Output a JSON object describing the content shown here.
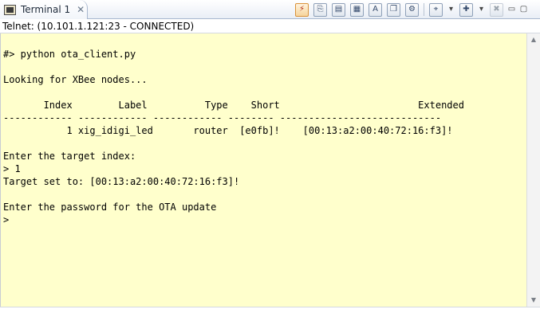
{
  "tab": {
    "title": "Terminal 1",
    "close_glyph": "✕",
    "icon": "terminal-icon"
  },
  "toolbar": {
    "icons": [
      "connect-icon",
      "disconnect-icon",
      "remote-command-icon",
      "scroll-lock-icon",
      "clear-icon",
      "copy-icon",
      "settings-icon",
      "pin-icon",
      "new-terminal-icon",
      "remove-icon",
      "minimize-icon",
      "maximize-icon"
    ]
  },
  "status": {
    "text": "Telnet: (10.101.1.121:23 - CONNECTED)"
  },
  "terminal": {
    "background": "#ffffcc",
    "lines": [
      "#> python ota_client.py",
      "",
      "Looking for XBee nodes...",
      "",
      "       Index        Label          Type    Short                        Extended",
      "------------ ------------ ------------ -------- ----------------------------",
      "           1 xig_idigi_led       router  [e0fb]!    [00:13:a2:00:40:72:16:f3]!",
      "",
      "Enter the target index:",
      "> 1",
      "Target set to: [00:13:a2:00:40:72:16:f3]!",
      "",
      "Enter the password for the OTA update",
      ">"
    ]
  }
}
